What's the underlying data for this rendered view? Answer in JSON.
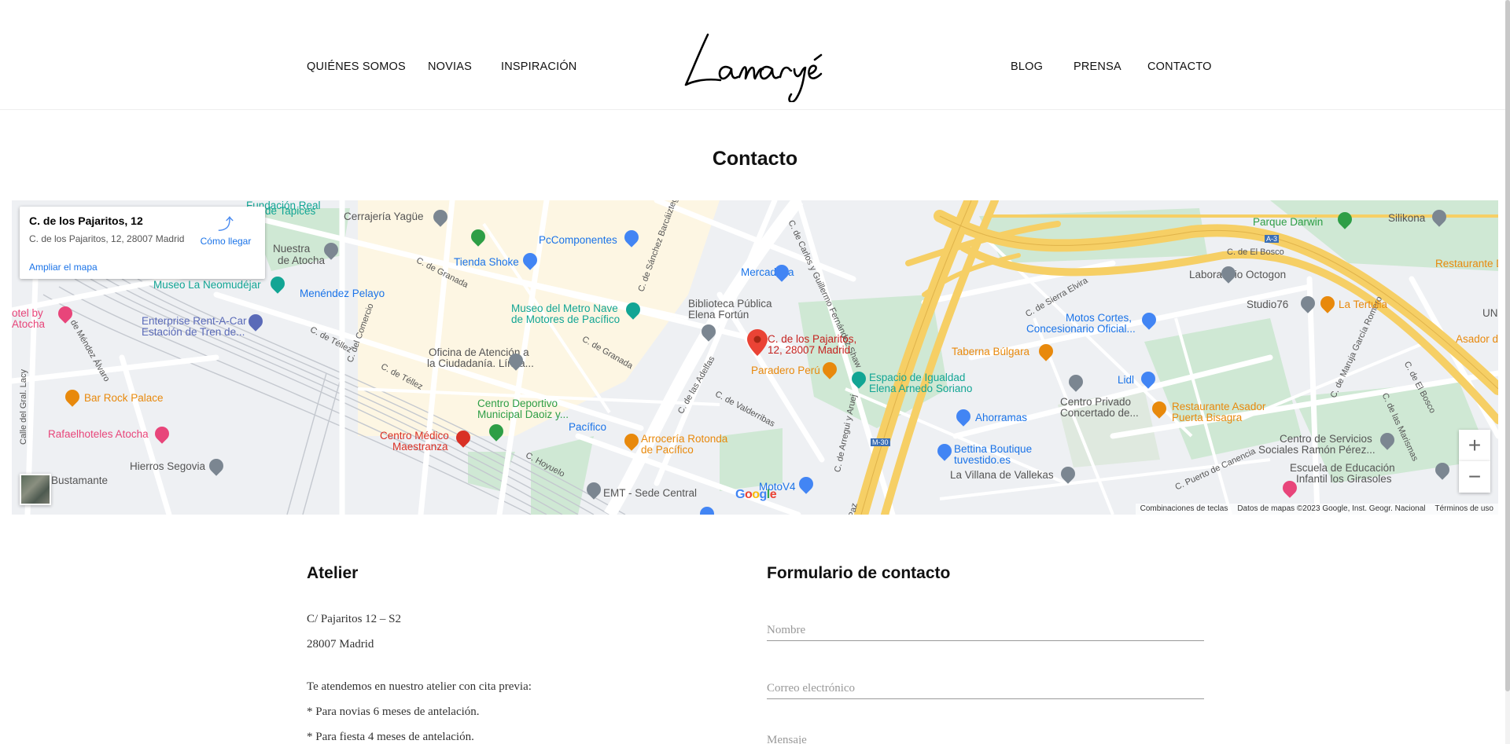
{
  "header": {
    "nav_left": [
      "QUIÉNES SOMOS",
      "NOVIAS",
      "INSPIRACIÓN"
    ],
    "nav_right": [
      "BLOG",
      "PRENSA",
      "CONTACTO"
    ],
    "logo_text": "Lamaryé"
  },
  "page": {
    "title": "Contacto"
  },
  "map": {
    "info_card": {
      "title": "C. de los Pajaritos, 12",
      "address": "C. de los Pajaritos, 12, 28007 Madrid",
      "directions": "Cómo llegar",
      "enlarge": "Ampliar el mapa"
    },
    "marker_label": "C. de los Pajaritos, 12, 28007 Madrid",
    "pois": {
      "fundacion": "Fundación Real",
      "tapices": "de Tapices",
      "nuestra": "Nuestra",
      "atocha_church": "de Atocha",
      "cerrajeria": "Cerrajería Yagüe",
      "museo_neo": "Museo La Neomudéjar",
      "menendez": "Menéndez Pelayo",
      "hotel1": "otel by",
      "hotel2": "Atocha",
      "enterprise1": "Enterprise Rent-A-Car",
      "enterprise2": "Estación de Tren de...",
      "bar_rock": "Bar Rock Palace",
      "rafael": "Rafaelhoteles Atocha",
      "hierros": "Hierros Segovia",
      "bustamante": "Bustamante",
      "pccomp": "PcComponentes",
      "tienda": "Tienda Shoke",
      "museo_metro1": "Museo del Metro Nave",
      "museo_metro2": "de Motores de Pacífico",
      "oficina1": "Oficina de Atención a",
      "oficina2": "la Ciudadanía. Línea...",
      "centro_dep1": "Centro Deportivo",
      "centro_dep2": "Municipal Daoiz y...",
      "centro_med1": "Centro Médico",
      "centro_med2": "Maestranza",
      "pacifico": "Pacífico",
      "emt": "EMT - Sede Central",
      "arroceria1": "Arrocería Rotonda",
      "arroceria2": "de Pacífico",
      "mercadona": "Mercadona",
      "biblioteca1": "Biblioteca Pública",
      "biblioteca2": "Elena Fortún",
      "paradero": "Paradero Perú",
      "espacio1": "Espacio de Igualdad",
      "espacio2": "Elena Arnedo Soriano",
      "motov4": "MotoV4",
      "taberna": "Taberna Búlgara",
      "motos1": "Motos Cortes,",
      "motos2": "Concesionario Oficial...",
      "lidl": "Lidl",
      "ahorramas": "Ahorramas",
      "centro_priv1": "Centro Privado",
      "centro_priv2": "Concertado de...",
      "bettina1": "Bettina Boutique",
      "bettina2": "tuvestido.es",
      "villana": "La Villana de Vallekas",
      "parque": "Parque Darwin",
      "silikona": "Silikona",
      "lab": "Laboratorio Octogon",
      "studio": "Studio76",
      "tertulia": "La Tertulia",
      "rest_dc": "Restaurante Dc",
      "asador": "Asador de",
      "un": "UN",
      "rest_asador1": "Restaurante Asador",
      "rest_asador2": "Puerta Bisagra",
      "servicios1": "Centro de Servicios",
      "servicios2": "Sociales Ramón Pérez...",
      "escuela1": "Escuela de Educación",
      "escuela2": "Infantil los Girasoles"
    },
    "streets": {
      "granada": "C. de Granada",
      "granada2": "C. de Granada",
      "tellez": "C. de Téllez",
      "tellez2": "C. de Téllez",
      "comercio": "C. del Comercio",
      "mendez": "C. de Méndez Álvaro",
      "gral_lacy": "Calle del Gral. Lacy",
      "hoyuelo": "C. Hoyuelo",
      "sanchez": "C. de Sánchez Barcáiztegui",
      "adelfas": "C. de las Adelfas",
      "valderribas": "C. de Valderribas",
      "carlos": "C. de Carlos y Guillermo Fernández Shaw",
      "arregui": "C. de Arregui y Aruej",
      "paz": "Paz",
      "sierra": "C. de Sierra Elvira",
      "bosco": "C. de El Bosco",
      "bosco2": "C. de El Bosco",
      "maruja": "C. de Maruja García Romero",
      "marismas": "C. de las Marismas",
      "puerto": "C. Puerto de Canencia",
      "m30": "M-30",
      "a3": "A-3"
    },
    "footer": {
      "shortcuts": "Combinaciones de teclas",
      "data": "Datos de mapas ©2023 Google, Inst. Geogr. Nacional",
      "terms": "Términos de uso"
    },
    "google": "Google",
    "zoom_in": "+",
    "zoom_out": "−"
  },
  "atelier": {
    "title": "Atelier",
    "address1": "C/ Pajaritos 12 – S2",
    "address2": "28007 Madrid",
    "note": "Te atendemos en nuestro atelier con cita previa:",
    "line1": "* Para novias 6 meses de antelación.",
    "line2": "* Para fiesta 4 meses de antelación."
  },
  "form": {
    "title": "Formulario de contacto",
    "name_placeholder": "Nombre",
    "email_placeholder": "Correo electrónico",
    "message_placeholder": "Mensaje"
  },
  "colors": {
    "accent_blue": "#1a73e8",
    "marker_red": "#ea4335",
    "highway_yellow": "#f6cf65",
    "park_green": "#c8e6c9",
    "poi_teal": "#12a594",
    "poi_orange": "#e8890c",
    "poi_blue": "#4285f4",
    "poi_pink": "#e8457a",
    "poi_grey": "#7b8691"
  }
}
